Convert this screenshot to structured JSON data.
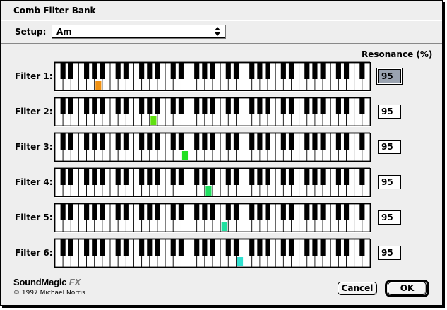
{
  "window": {
    "title": "Comb Filter Bank"
  },
  "setup": {
    "label": "Setup:",
    "value": "Am"
  },
  "resonance_header": "Resonance (%)",
  "filters": [
    {
      "label": "Filter 1:",
      "resonance": "95",
      "selected": true,
      "marker_color": "#f09010",
      "marker_white_key": 5
    },
    {
      "label": "Filter 2:",
      "resonance": "95",
      "selected": false,
      "marker_color": "#60e010",
      "marker_white_key": 12
    },
    {
      "label": "Filter 3:",
      "resonance": "95",
      "selected": false,
      "marker_color": "#20e020",
      "marker_white_key": 16
    },
    {
      "label": "Filter 4:",
      "resonance": "95",
      "selected": false,
      "marker_color": "#20e060",
      "marker_white_key": 19
    },
    {
      "label": "Filter 5:",
      "resonance": "95",
      "selected": false,
      "marker_color": "#20e0a0",
      "marker_white_key": 21
    },
    {
      "label": "Filter 6:",
      "resonance": "95",
      "selected": false,
      "marker_color": "#30e0d0",
      "marker_white_key": 23
    }
  ],
  "branding": {
    "name": "SoundMagic",
    "fx": "FX",
    "copyright": "© 1997 Michael Norris"
  },
  "buttons": {
    "cancel": "Cancel",
    "ok": "OK"
  },
  "icons": {
    "popup": "up-down-arrows-icon"
  }
}
